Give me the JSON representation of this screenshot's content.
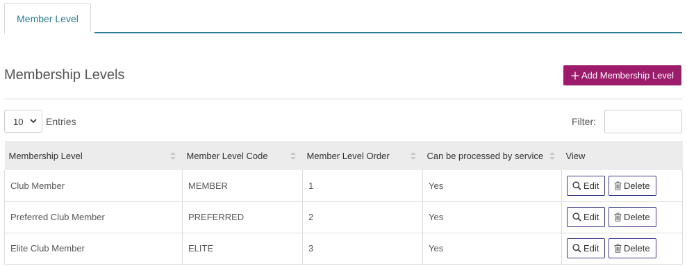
{
  "tabs": [
    {
      "label": "Member Level",
      "active": true
    }
  ],
  "title": "Membership Levels",
  "add_button": {
    "label": "Add Membership Level",
    "icon": "plus-icon",
    "color": "#9c1b6b"
  },
  "entries": {
    "value": "10",
    "label": "Entries"
  },
  "filter": {
    "label": "Filter:",
    "value": ""
  },
  "table": {
    "columns": [
      "Membership Level",
      "Member Level Code",
      "Member Level Order",
      "Can be processed by service",
      "View"
    ],
    "rows": [
      {
        "level": "Club Member",
        "code": "MEMBER",
        "order": "1",
        "service": "Yes"
      },
      {
        "level": "Preferred Club Member",
        "code": "PREFERRED",
        "order": "2",
        "service": "Yes"
      },
      {
        "level": "Elite Club Member",
        "code": "ELITE",
        "order": "3",
        "service": "Yes"
      }
    ],
    "edit_label": "Edit",
    "delete_label": "Delete"
  },
  "accent_color": "#2c7b92"
}
